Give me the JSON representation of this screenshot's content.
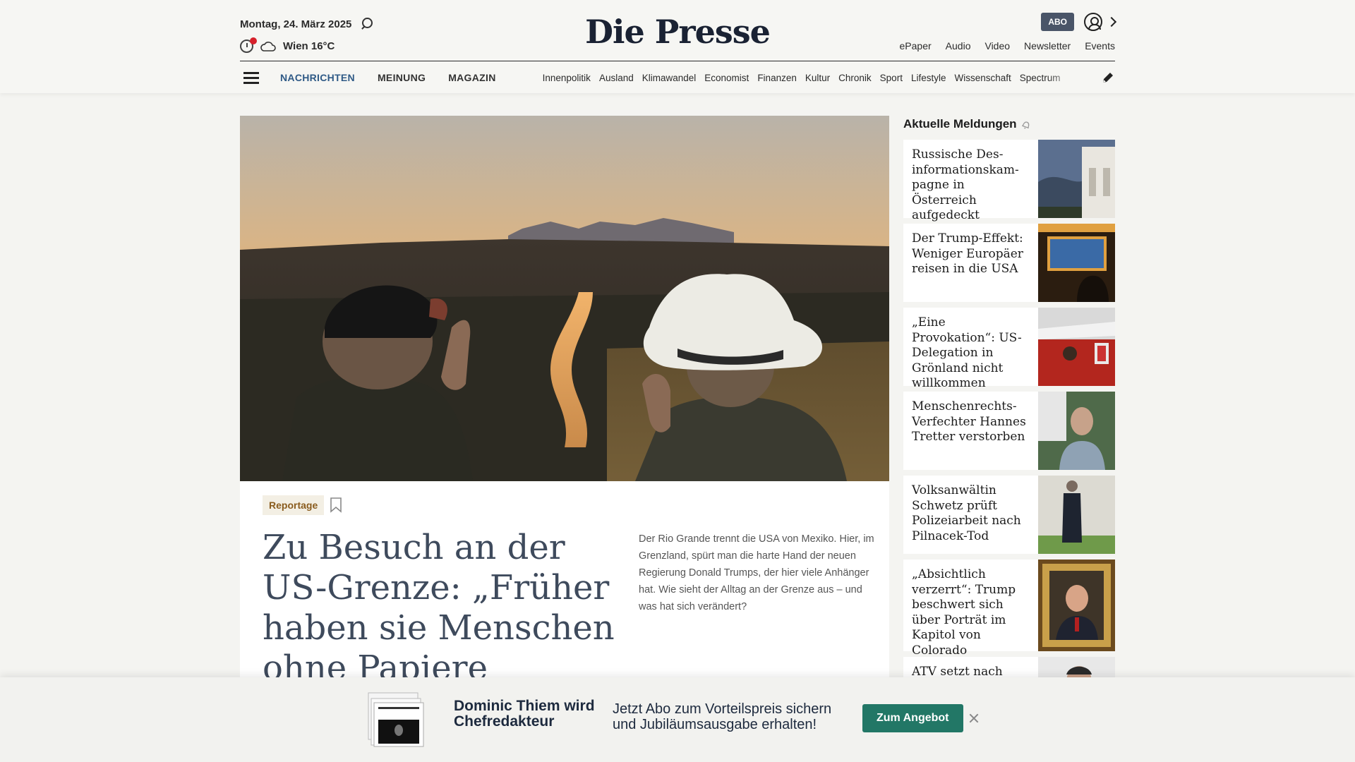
{
  "header": {
    "date": "Montag, 24. März 2025",
    "weather": "Wien 16°C",
    "logo": "Die Presse",
    "abo_label": "ABO",
    "service_links": [
      "ePaper",
      "Audio",
      "Video",
      "Newsletter",
      "Events"
    ]
  },
  "nav": {
    "main": [
      "NACHRICHTEN",
      "MEINUNG",
      "MAGAZIN"
    ],
    "sub": [
      "Innenpolitik",
      "Ausland",
      "Klimawandel",
      "Economist",
      "Finanzen",
      "Kultur",
      "Chronik",
      "Sport",
      "Lifestyle",
      "Wissenschaft",
      "Spectrum"
    ]
  },
  "article": {
    "tag": "Reportage",
    "headline": "Zu Besuch an der US-Grenze: „Früher haben sie Menschen ohne Papiere abgeschoben",
    "teaser": "Der Rio Grande trennt die USA von Mexiko. Hier, im Grenzland, spürt man die harte Hand der neuen Regierung Donald Trumps, der hier viele Anhänger hat. Wie sieht der Alltag an der Grenze aus – und was hat sich verändert?"
  },
  "sidebar": {
    "title": "Aktuelle Meldungen",
    "items": [
      {
        "title": "Russische Des-informationskam-pagne in Österreich aufgedeckt"
      },
      {
        "title": "Der Trump-Effekt: Weniger Europäer reisen in die USA"
      },
      {
        "title": "„Eine Provokation“: US-Delegation in Grönland nicht willkommen"
      },
      {
        "title": "Menschenrechts-Verfechter Hannes Tretter verstorben"
      },
      {
        "title": "Volksanwältin Schwetz prüft Polizeiarbeit nach Pilnacek-Tod"
      },
      {
        "title": "„Absichtlich verzerrt“: Trump beschwert sich über Porträt im Kapitol von Colorado"
      },
      {
        "title": "ATV setzt nach"
      }
    ]
  },
  "promo": {
    "name": "Dominic Thiem wird Chefredakteur",
    "offer": "Jetzt Abo zum Vorteilspreis sichern und Jubiläumsausgabe erhalten!",
    "button": "Zum Angebot"
  },
  "colors": {
    "accent_nav": "#2f5a86",
    "promo_button": "#227766",
    "tag_text": "#8a5c1e",
    "abo_badge": "#4a5568"
  }
}
